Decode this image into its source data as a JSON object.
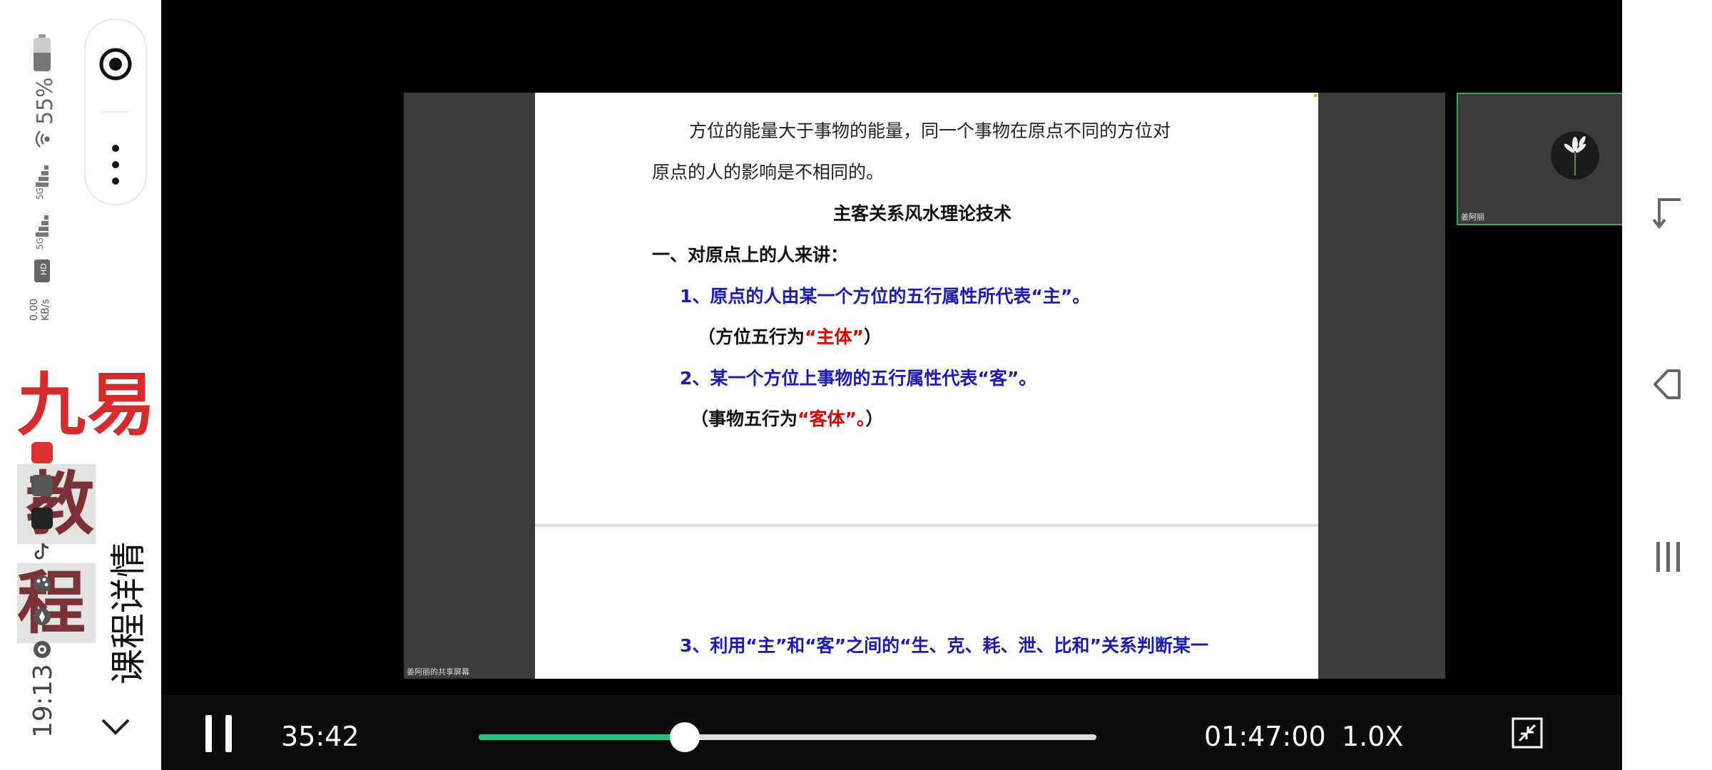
{
  "status_bar": {
    "time": "19:13",
    "battery_percent": "55%",
    "battery_level": 0.55,
    "network_speed_value": "0.00",
    "network_speed_unit": "KB/s",
    "signal_icons": [
      "hd-icon",
      "5g-signal-icon",
      "5g-signal-icon",
      "wifi-icon"
    ],
    "app_icons": [
      "red-app-icon",
      "send-icon",
      "tv-app-icon",
      "tiktok-icon",
      "palette-icon",
      "compass-icon",
      "camera-app-icon"
    ]
  },
  "watermark": {
    "part1": "九易",
    "part2": "教程"
  },
  "sidebar": {
    "title": "课程详情",
    "collapse_icon": "chevron-down-icon"
  },
  "mini_controls": {
    "record_icon": "record-target-icon",
    "more_icon": "more-vertical-icon"
  },
  "slide": {
    "para_line1": "方位的能量大于事物的能量，同一个事物在原点不同的方位对",
    "para_line2": "原点的人的影响是不相同的。",
    "title": "主客关系风水理论技术",
    "section1": "一、对原点上的人来讲：",
    "item1": "1、原点的人由某一个方位的五行属性所代表“主”。",
    "item1_note_prefix": "（方位五行为",
    "item1_note_highlight": "“主体”",
    "item1_note_suffix": "）",
    "item2": "2、某一个方位上事物的五行属性代表“客”。",
    "item2_note_prefix": "（事物五行为",
    "item2_note_highlight": "“客体”。",
    "item2_note_suffix": "）",
    "item3": "3、利用“主”和“客”之间的“生、克、耗、泄、比和”关系判断某一"
  },
  "share_caption": "姜阿丽的共享屏幕",
  "camera": {
    "name": "姜阿丽",
    "avatar_icon": "flower-avatar-icon"
  },
  "player": {
    "elapsed": "35:42",
    "total": "01:47:00",
    "speed": "1.0X",
    "progress": 0.3336,
    "play_state": "playing",
    "fullscreen_icon": "exit-fullscreen-icon",
    "accent_color": "#27c27a"
  },
  "nav_bar": {
    "icons": [
      "rotate-icon",
      "back-icon",
      "recents-icon"
    ]
  }
}
